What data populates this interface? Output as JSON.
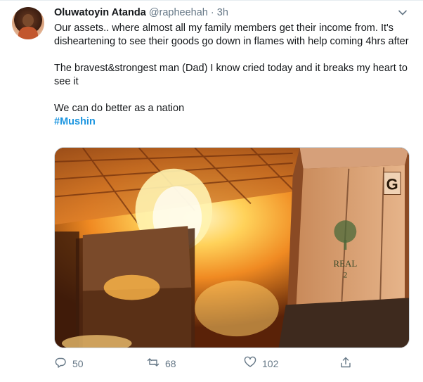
{
  "tweet": {
    "author_name": "Oluwatoyin Atanda",
    "handle": "@rapheehah",
    "separator": "·",
    "time": "3h",
    "paragraphs": [
      "Our assets.. where almost all my family members get their income from. It's disheartening to see their goods go down in flames with help coming 4hrs after",
      "The bravest&strongest man (Dad) I know cried today and it breaks my heart to see it",
      "We can do better as a nation"
    ],
    "hashtag": "#Mushin",
    "media_box_letter": "G",
    "media_box_stamp": "REAL",
    "media_box_stamp_line2": "2"
  },
  "actions": {
    "reply_count": "50",
    "retweet_count": "68",
    "like_count": "102"
  },
  "icons": {
    "menu": "chevron-down-icon",
    "reply": "reply-icon",
    "retweet": "retweet-icon",
    "like": "heart-icon",
    "share": "share-icon"
  },
  "colors": {
    "text": "#14171a",
    "muted": "#657786",
    "link": "#1b95e0"
  }
}
